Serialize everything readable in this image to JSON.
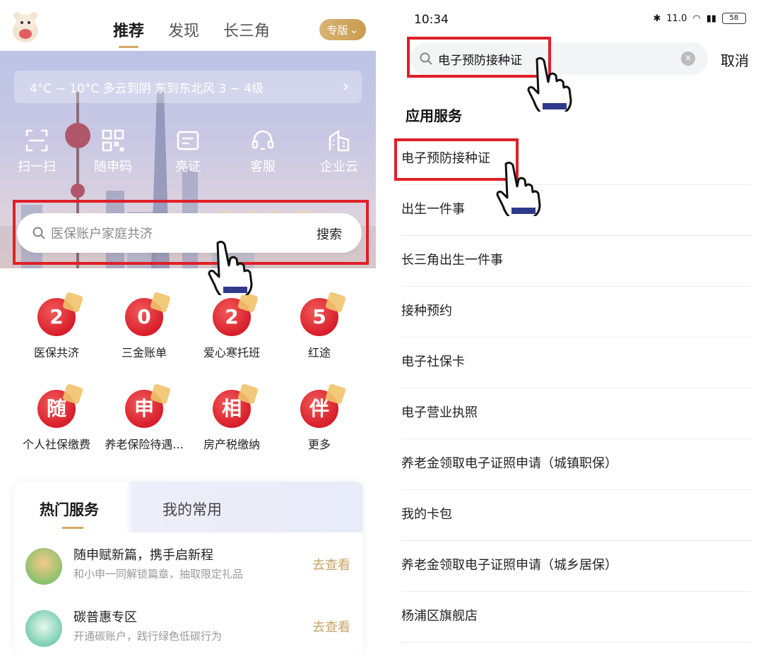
{
  "left": {
    "tabs": [
      "推荐",
      "发现",
      "长三角"
    ],
    "edition_label": "专版",
    "weather": "4°C ~ 10°C  多云到阴  东到东北风  3 ~ 4级",
    "quick_actions": [
      "扫一扫",
      "随申码",
      "亮证",
      "客服",
      "企业云"
    ],
    "search": {
      "placeholder": "医保账户家庭共济",
      "button": "搜索"
    },
    "grid": [
      {
        "badge": "2",
        "label": "医保共济"
      },
      {
        "badge": "0",
        "label": "三金账单"
      },
      {
        "badge": "2",
        "label": "爱心寒托班"
      },
      {
        "badge": "5",
        "label": "红途"
      },
      {
        "badge": "随",
        "label": "个人社保缴费"
      },
      {
        "badge": "申",
        "label": "养老保险待遇..."
      },
      {
        "badge": "相",
        "label": "房产税缴纳"
      },
      {
        "badge": "伴",
        "label": "更多"
      }
    ],
    "hot_tabs": [
      "热门服务",
      "我的常用"
    ],
    "hot_items": [
      {
        "title": "随申赋新篇，携手启新程",
        "subtitle": "和小申一同解锁篇章，抽取限定礼品",
        "action": "去查看"
      },
      {
        "title": "碳普惠专区",
        "subtitle": "开通碳账户，践行绿色低碳行为",
        "action": "去查看"
      }
    ]
  },
  "right": {
    "status_time": "10:34",
    "status_net": "11.0",
    "battery": "58",
    "search_value": "电子预防接种证",
    "cancel": "取消",
    "section_title": "应用服务",
    "results": [
      "电子预防接种证",
      "出生一件事",
      "长三角出生一件事",
      "接种预约",
      "电子社保卡",
      "电子营业执照",
      "养老金领取电子证照申请（城镇职保）",
      "我的卡包",
      "养老金领取电子证照申请（城乡居保）",
      "杨浦区旗舰店"
    ]
  },
  "colors": {
    "accent_gold": "#d2a962",
    "highlight_red": "#e01f26",
    "badge_red": "#d81e2a"
  }
}
